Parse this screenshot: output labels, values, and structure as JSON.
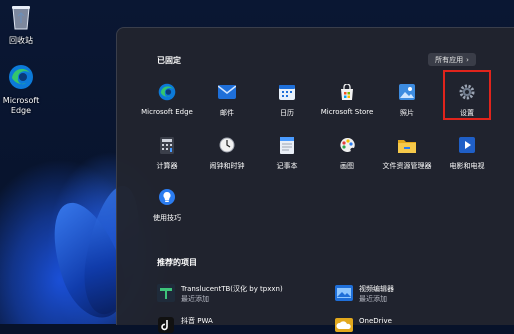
{
  "desktop": {
    "icons": [
      {
        "label": "回收站"
      },
      {
        "label": "Microsoft Edge"
      }
    ]
  },
  "start_menu": {
    "pinned_title": "已固定",
    "all_apps_label": "所有应用",
    "all_apps_chevron": "›",
    "pinned_apps": [
      {
        "label": "Microsoft Edge",
        "icon": "edge-icon"
      },
      {
        "label": "邮件",
        "icon": "mail-icon"
      },
      {
        "label": "日历",
        "icon": "calendar-icon"
      },
      {
        "label": "Microsoft Store",
        "icon": "store-icon"
      },
      {
        "label": "照片",
        "icon": "photos-icon"
      },
      {
        "label": "设置",
        "icon": "settings-icon"
      },
      {
        "label": "计算器",
        "icon": "calculator-icon"
      },
      {
        "label": "闹钟和时钟",
        "icon": "clock-icon"
      },
      {
        "label": "记事本",
        "icon": "notepad-icon"
      },
      {
        "label": "画图",
        "icon": "paint-icon"
      },
      {
        "label": "文件资源管理器",
        "icon": "folder-icon"
      },
      {
        "label": "电影和电视",
        "icon": "movies-icon"
      },
      {
        "label": "使用技巧",
        "icon": "tips-icon"
      }
    ],
    "recommended_title": "推荐的项目",
    "recommended": [
      {
        "title": "TranslucentTB(汉化 by tpxxn)",
        "subtitle": "最近添加",
        "icon": "translucenttb-icon"
      },
      {
        "title": "视频编辑器",
        "subtitle": "最近添加",
        "icon": "video-editor-icon"
      },
      {
        "title": "抖音 PWA",
        "subtitle": "",
        "icon": "douyin-icon"
      },
      {
        "title": "OneDrive",
        "subtitle": "",
        "icon": "onedrive-icon"
      }
    ]
  }
}
